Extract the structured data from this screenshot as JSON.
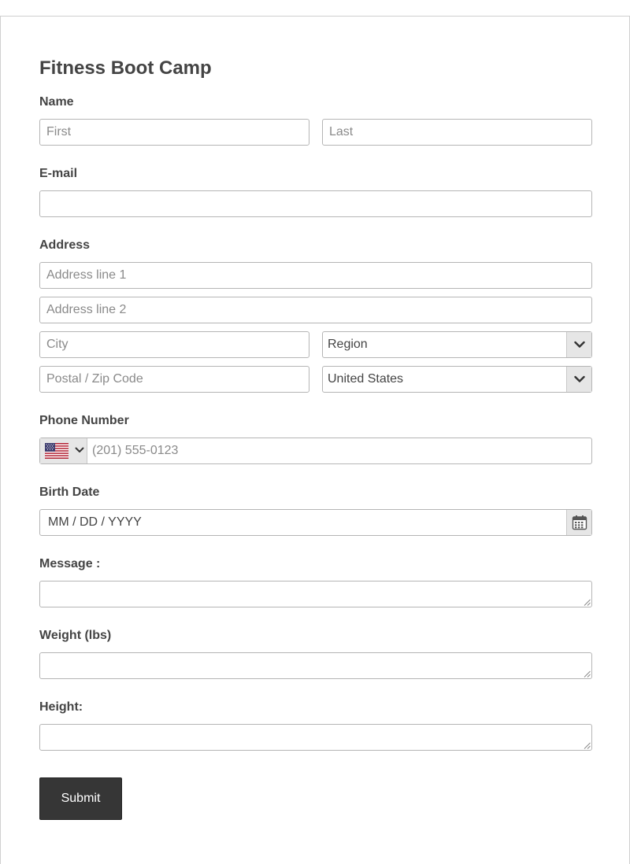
{
  "form": {
    "title": "Fitness Boot Camp",
    "name": {
      "label": "Name",
      "first_placeholder": "First",
      "last_placeholder": "Last"
    },
    "email": {
      "label": "E-mail",
      "value": ""
    },
    "address": {
      "label": "Address",
      "line1_placeholder": "Address line 1",
      "line2_placeholder": "Address line 2",
      "city_placeholder": "City",
      "region_selected": "Region",
      "postal_placeholder": "Postal / Zip Code",
      "country_selected": "United States"
    },
    "phone": {
      "label": "Phone Number",
      "placeholder": "(201) 555-0123",
      "country_flag": "us-flag-icon"
    },
    "birth_date": {
      "label": "Birth Date",
      "placeholder": "MM / DD / YYYY"
    },
    "message": {
      "label": "Message :"
    },
    "weight": {
      "label": "Weight (lbs)"
    },
    "height": {
      "label": "Height:"
    },
    "submit_label": "Submit"
  },
  "colors": {
    "text": "#444444",
    "border": "#b5b5b5",
    "button_bg": "#363636",
    "select_btn_bg": "#e6e6e6"
  }
}
